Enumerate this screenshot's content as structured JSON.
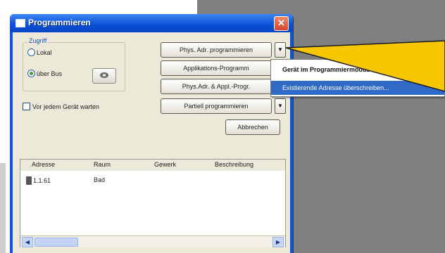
{
  "window": {
    "title": "Programmieren",
    "close_glyph": "✕"
  },
  "access": {
    "label": "Zugriff",
    "options": [
      "Lokal",
      "über Bus"
    ],
    "selected": "über Bus",
    "settings_icon": "gear-icon"
  },
  "wait_checkbox": {
    "label": "Vor jedem Gerät warten",
    "checked": false
  },
  "buttons": {
    "phys_addr": "Phys. Adr. programmieren",
    "application": "Applikations-Programm",
    "phys_appl": "Phys.Adr. & Appl.-Progr.",
    "partial": "Partiell programmieren",
    "cancel": "Abbrechen"
  },
  "table": {
    "columns": [
      "Adresse",
      "Raum",
      "Gewerk",
      "Beschreibung"
    ],
    "rows": [
      {
        "address": "1.1.61",
        "room": "Bad",
        "trade": "",
        "description": ""
      }
    ]
  },
  "popup_menu": {
    "items": [
      {
        "label": "Gerät im Programmiermodus",
        "bold": true
      },
      {
        "label": "Existierende Adresse überschreiben...",
        "highlighted": true
      }
    ]
  },
  "colors": {
    "titlebar": "#0a4fd6",
    "client_bg": "#ece9d8",
    "highlight": "#3169c6",
    "callout_yellow": "#f7c600",
    "close_red": "#d5452a"
  }
}
